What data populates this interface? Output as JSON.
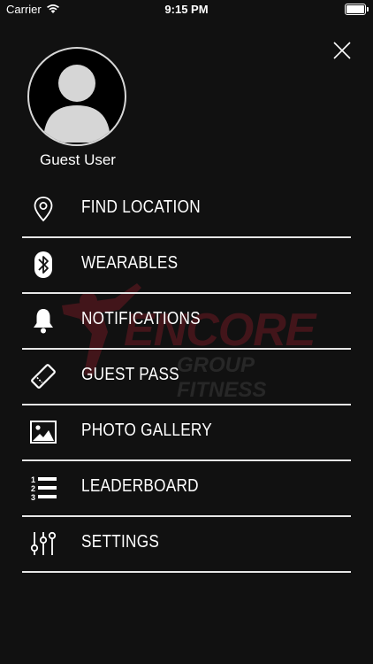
{
  "status_bar": {
    "carrier": "Carrier",
    "time": "9:15 PM"
  },
  "profile": {
    "name": "Guest User"
  },
  "watermark": {
    "brand": "ENCORE",
    "subtitle": "GROUP FITNESS"
  },
  "menu": [
    {
      "label": "FIND LOCATION",
      "icon": "location-pin-icon"
    },
    {
      "label": "WEARABLES",
      "icon": "bluetooth-icon"
    },
    {
      "label": "NOTIFICATIONS",
      "icon": "bell-icon"
    },
    {
      "label": "GUEST PASS",
      "icon": "ticket-icon"
    },
    {
      "label": "PHOTO GALLERY",
      "icon": "image-icon"
    },
    {
      "label": "LEADERBOARD",
      "icon": "numbered-list-icon"
    },
    {
      "label": "SETTINGS",
      "icon": "sliders-icon"
    }
  ],
  "colors": {
    "background": "#111111",
    "divider": "#e6e6e6",
    "brand_red": "#6a1a22"
  }
}
